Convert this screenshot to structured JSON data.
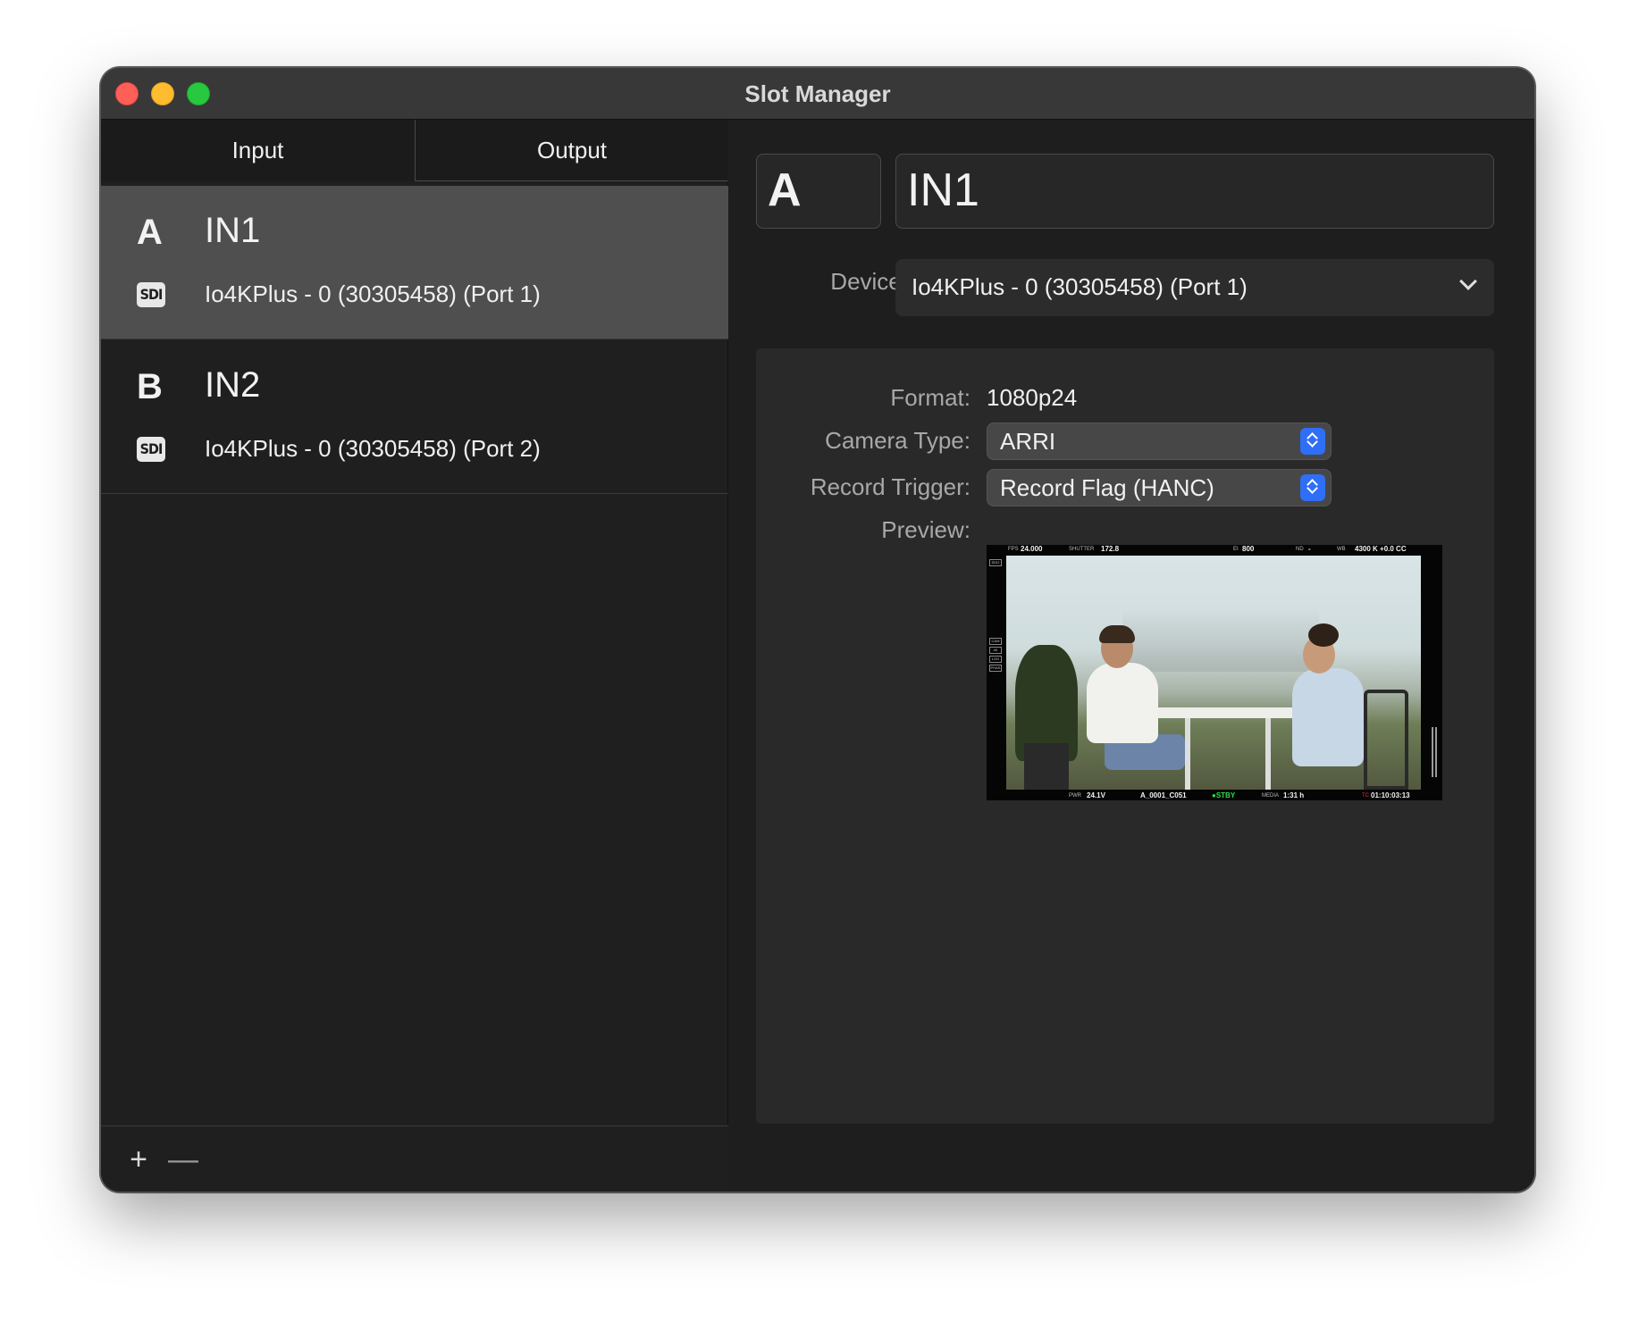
{
  "window": {
    "title": "Slot Manager"
  },
  "tabs": [
    {
      "label": "Input",
      "selected": true
    },
    {
      "label": "Output",
      "selected": false
    }
  ],
  "slots": [
    {
      "letter": "A",
      "name": "IN1",
      "icon": "sdi-icon",
      "icon_text": "SDI",
      "device": "Io4KPlus - 0 (30305458) (Port 1)",
      "selected": true
    },
    {
      "letter": "B",
      "name": "IN2",
      "icon": "sdi-icon",
      "icon_text": "SDI",
      "device": "Io4KPlus - 0 (30305458) (Port 2)",
      "selected": false
    }
  ],
  "footer": {
    "add_label": "+",
    "remove_label": "—"
  },
  "detail": {
    "slot_letter": "A",
    "slot_name": "IN1",
    "device_label": "Device:",
    "device_value": "Io4KPlus - 0 (30305458) (Port 1)",
    "format_label": "Format:",
    "format_value": "1080p24",
    "camera_type_label": "Camera Type:",
    "camera_type_value": "ARRI",
    "record_trigger_label": "Record Trigger:",
    "record_trigger_value": "Record Flag (HANC)",
    "preview_label": "Preview:"
  },
  "preview_hud": {
    "fps_label": "FPS",
    "fps": "24.000",
    "shutter_label": "SHUTTER",
    "shutter": "172.8",
    "ei_label": "EI",
    "ei": "800",
    "nd_label": "ND",
    "nd": "-",
    "wb_label": "WB",
    "wb": "4300 K +0.0 CC",
    "pwr_label": "PWR",
    "pwr": "24.1V",
    "clip": "A_0001_C051",
    "status": "●STBY",
    "media_label": "MEDIA",
    "media": "1:31 h",
    "tc_label": "TC",
    "tc": "01:10:03:13",
    "side_top": "SDI2",
    "side_tags": [
      "CAM",
      "4K",
      "LOG",
      "PHAS"
    ]
  },
  "colors": {
    "accent": "#2f6ef6",
    "selected_row": "#4f4f4f",
    "close": "#fe5f57",
    "minimize": "#febc2e",
    "maximize": "#28c840",
    "standby": "#2ddc4c"
  }
}
